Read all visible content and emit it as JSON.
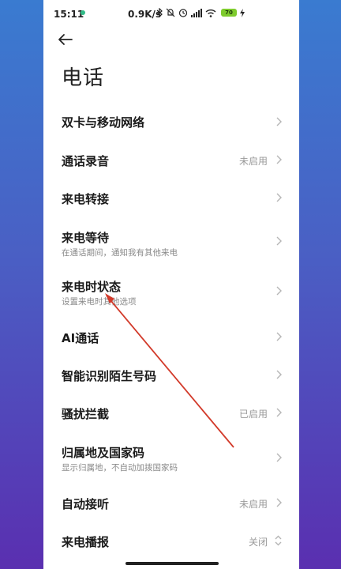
{
  "status_bar": {
    "time": "15:11",
    "network_speed": "0.9K/s",
    "battery": "70",
    "icons": [
      "bluetooth-icon",
      "mute-bell-icon",
      "alarm-icon",
      "signal-icon",
      "wifi-icon",
      "battery-icon",
      "charging-icon"
    ]
  },
  "header": {
    "title": "电话",
    "back_icon": "back-arrow-icon"
  },
  "settings": [
    {
      "label": "双卡与移动网络",
      "subtitle": "",
      "value": ""
    },
    {
      "label": "通话录音",
      "subtitle": "",
      "value": "未启用"
    },
    {
      "label": "来电转接",
      "subtitle": "",
      "value": ""
    },
    {
      "label": "来电等待",
      "subtitle": "在通话期间，通知我有其他来电",
      "value": ""
    },
    {
      "label": "来电时状态",
      "subtitle": "设置来电时其他选项",
      "value": ""
    },
    {
      "label": "AI通话",
      "subtitle": "",
      "value": ""
    },
    {
      "label": "智能识别陌生号码",
      "subtitle": "",
      "value": ""
    },
    {
      "label": "骚扰拦截",
      "subtitle": "",
      "value": "已启用"
    },
    {
      "label": "归属地及国家码",
      "subtitle": "显示归属地，不自动加拨国家码",
      "value": ""
    },
    {
      "label": "自动接听",
      "subtitle": "",
      "value": "未启用"
    },
    {
      "label": "来电播报",
      "subtitle": "",
      "value": "关闭"
    }
  ],
  "colors": {
    "annotation_arrow": "#d23a2a",
    "background_gradient_top": "#3a7bd0",
    "background_gradient_bottom": "#5a2fb0"
  }
}
